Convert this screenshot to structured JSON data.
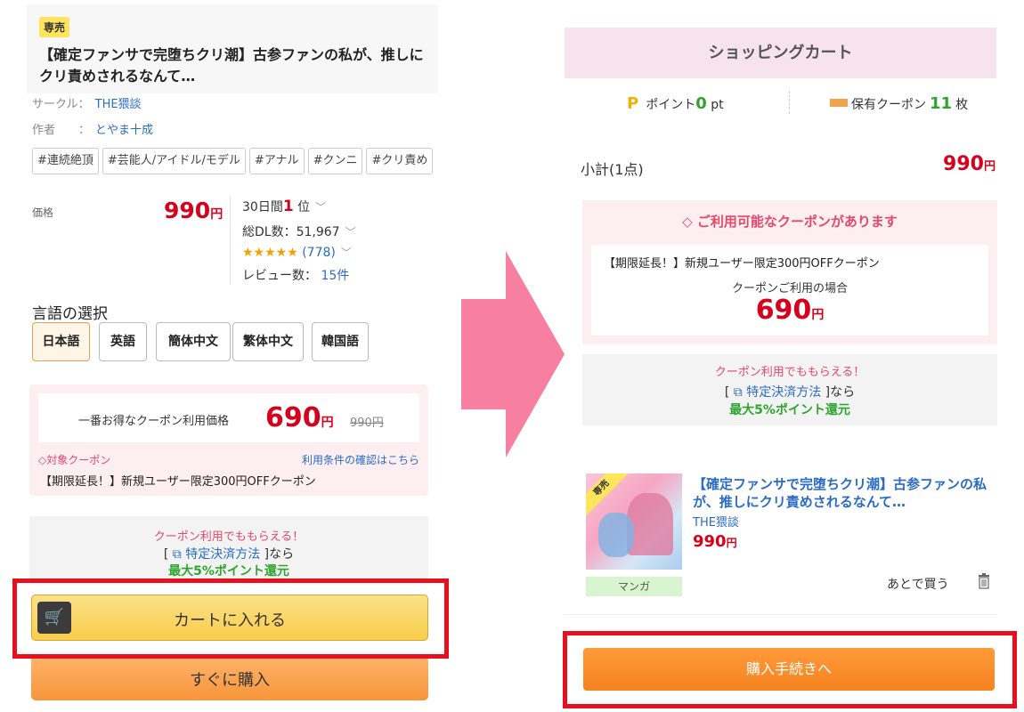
{
  "left": {
    "badge": "専売",
    "title": "【確定ファンサで完堕ちクリ潮】古参ファンの私が、推しにクリ責めされるなんて…",
    "circle_label": "サークル：",
    "circle": "THE猥談",
    "author_label": "作者　　：",
    "author": "とやま十成",
    "tags": [
      "#連続絶頂",
      "#芸能人/アイドル/モデル",
      "#アナル",
      "#クンニ",
      "#クリ責め"
    ],
    "price_label": "価格",
    "price": "990",
    "yen": "円",
    "rank_prefix": "30日間",
    "rank_num": "1",
    "rank_suffix": "位",
    "downloads": "総DL数：51,967",
    "stars": "★★★★★",
    "rating_count": "(778)",
    "reviews_label": "レビュー数：",
    "reviews": "15件",
    "lang_title": "言語の選択",
    "languages": [
      "日本語",
      "英語",
      "簡体中文",
      "繁体中文",
      "韓国語"
    ],
    "best_label": "一番お得なクーポン利用価格",
    "best_price": "690",
    "strike_price": "990円",
    "target_coupon": "◇対象クーポン",
    "terms_link": "利用条件の確認はこちら",
    "coupon_name": "【期限延長！】新規ユーザー限定300円OFFクーポン",
    "pay_pink": "クーポン利用でももらえる！",
    "pay_open": "[",
    "pay_link": "特定決済方法",
    "pay_close": "]なら",
    "pay_green": "最大5%ポイント還元",
    "cart_button": "カートに入れる",
    "buy_button": "すぐに購入"
  },
  "right": {
    "header": "ショッピングカート",
    "points_p": "P",
    "points_label": "ポイント",
    "points_value": "0",
    "points_unit": "pt",
    "coupons_label": "保有クーポン",
    "coupons_value": "11",
    "coupons_unit": "枚",
    "subtotal_label": "小計(1点)",
    "subtotal": "990",
    "yen": "円",
    "coupon_available": "ご利用可能なクーポンがあります",
    "coupon_name": "【期限延長！】新規ユーザー限定300円OFFクーポン",
    "coupon_when": "クーポンご利用の場合",
    "coupon_price": "690",
    "pay_pink": "クーポン利用でももらえる！",
    "pay_open": "[",
    "pay_link": "特定決済方法",
    "pay_close": "]なら",
    "pay_green": "最大5%ポイント還元",
    "thumb_badge": "専売",
    "genre": "マンガ",
    "item_title": "【確定ファンサで完堕ちクリ潮】古参ファンの私が、推しにクリ責めされるなんて…",
    "item_circle": "THE猥談",
    "item_price": "990",
    "later": "あとで買う",
    "proceed_button": "購入手続きへ"
  },
  "colors": {
    "price_red": "#d6001c",
    "link_blue": "#2a6cc4",
    "coupon_pink": "#e2496b",
    "green": "#2fa52f",
    "highlight_frame": "#e8101f",
    "arrow_pink": "#f77fa2",
    "cart_yellow": "#f8cd4a",
    "buy_orange": "#f7953a"
  },
  "icons": [
    "cart-icon",
    "trash-icon",
    "coupon-tag-icon",
    "external-link-icon",
    "chevron-down-icon",
    "ticket-icon"
  ]
}
